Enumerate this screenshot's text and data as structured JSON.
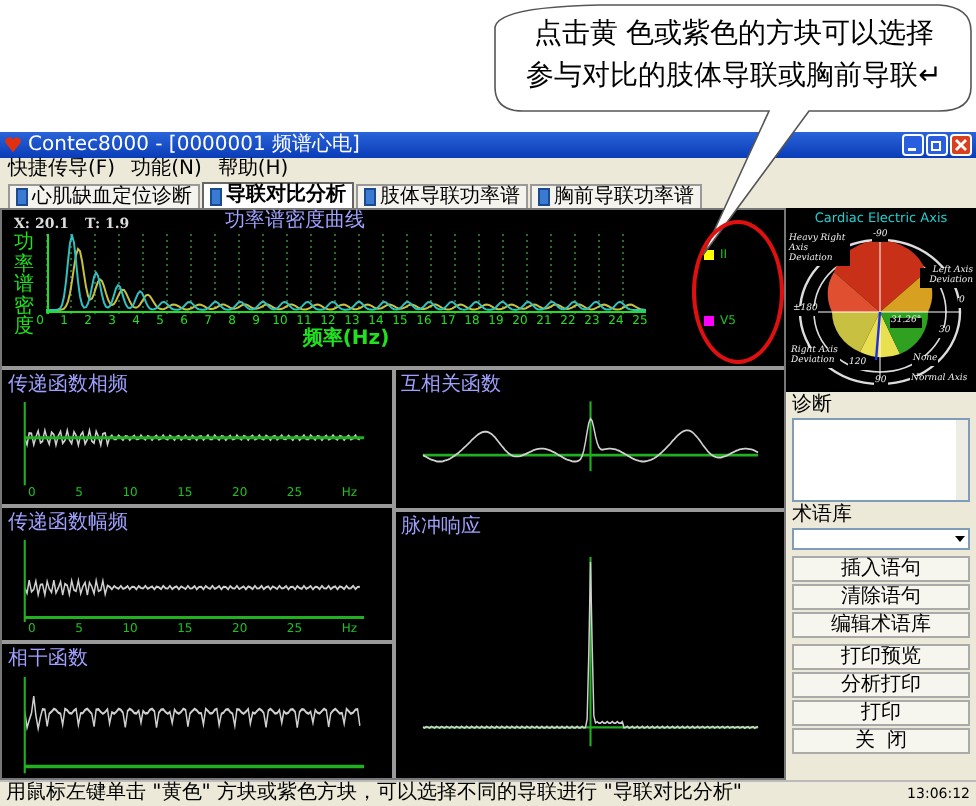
{
  "annotation": {
    "lines": [
      "点击黄 色或紫色的方块可以选择",
      "参与对比的肢体导联或胸前导联↵"
    ]
  },
  "window": {
    "title": "Contec8000 - [0000001  频谱心电]"
  },
  "menu": [
    "快捷传导(F)",
    "功能(N)",
    "帮助(H)"
  ],
  "tabs": [
    {
      "label": "心肌缺血定位诊断",
      "selected": false
    },
    {
      "label": "导联对比分析",
      "selected": true
    },
    {
      "label": "肢体导联功率谱",
      "selected": false
    },
    {
      "label": "胸前导联功率谱",
      "selected": false
    }
  ],
  "spectrum": {
    "title": "功率谱密度曲线",
    "readout_x": "X: 20.1",
    "readout_t": "T: 1.9",
    "ylabel": "功率谱密度",
    "xlabel": "频率(Hz)",
    "x_ticks": [
      "0",
      "1",
      "2",
      "3",
      "4",
      "5",
      "6",
      "7",
      "8",
      "9",
      "10",
      "11",
      "12",
      "13",
      "14",
      "15",
      "16",
      "17",
      "18",
      "19",
      "20",
      "21",
      "22",
      "23",
      "24",
      "25"
    ]
  },
  "leads": [
    {
      "label": "II",
      "color": "#ffff00"
    },
    {
      "label": "V5",
      "color": "#ff00ff"
    }
  ],
  "panels": [
    {
      "kind": "phase",
      "title": "传递函数相频",
      "x_ticks": [
        "0",
        "5",
        "10",
        "15",
        "20",
        "25"
      ],
      "unit": "Hz"
    },
    {
      "kind": "correlation",
      "title": "互相关函数"
    },
    {
      "kind": "amplitude",
      "title": "传递函数幅频",
      "x_ticks": [
        "0",
        "5",
        "10",
        "15",
        "20",
        "25"
      ],
      "unit": "Hz"
    },
    {
      "kind": "impulse",
      "title": "脉冲响应"
    },
    {
      "kind": "coherence",
      "title": "相干函数"
    }
  ],
  "axis": {
    "title": "Cardiac Electric Axis",
    "labels": [
      "-90",
      "Heavy Right Axis Deviation",
      "Left Axis Deviation",
      "±180",
      "0",
      "31.26°",
      "30",
      "Right Axis Deviation",
      "120",
      "None",
      "90",
      "Normal Axis"
    ]
  },
  "diagnosis": {
    "label": "诊断"
  },
  "phrasebook": {
    "label": "术语库"
  },
  "button_groups": [
    [
      "插入语句",
      "清除语句",
      "编辑术语库"
    ],
    [
      "打印预览",
      "分析打印",
      "打印",
      "关  闭"
    ]
  ],
  "status_bar": {
    "message": "用鼠标左键单击 \"黄色\" 方块或紫色方块，可以选择不同的导联进行 \"导联对比分析\"",
    "time": "13:06:12"
  }
}
